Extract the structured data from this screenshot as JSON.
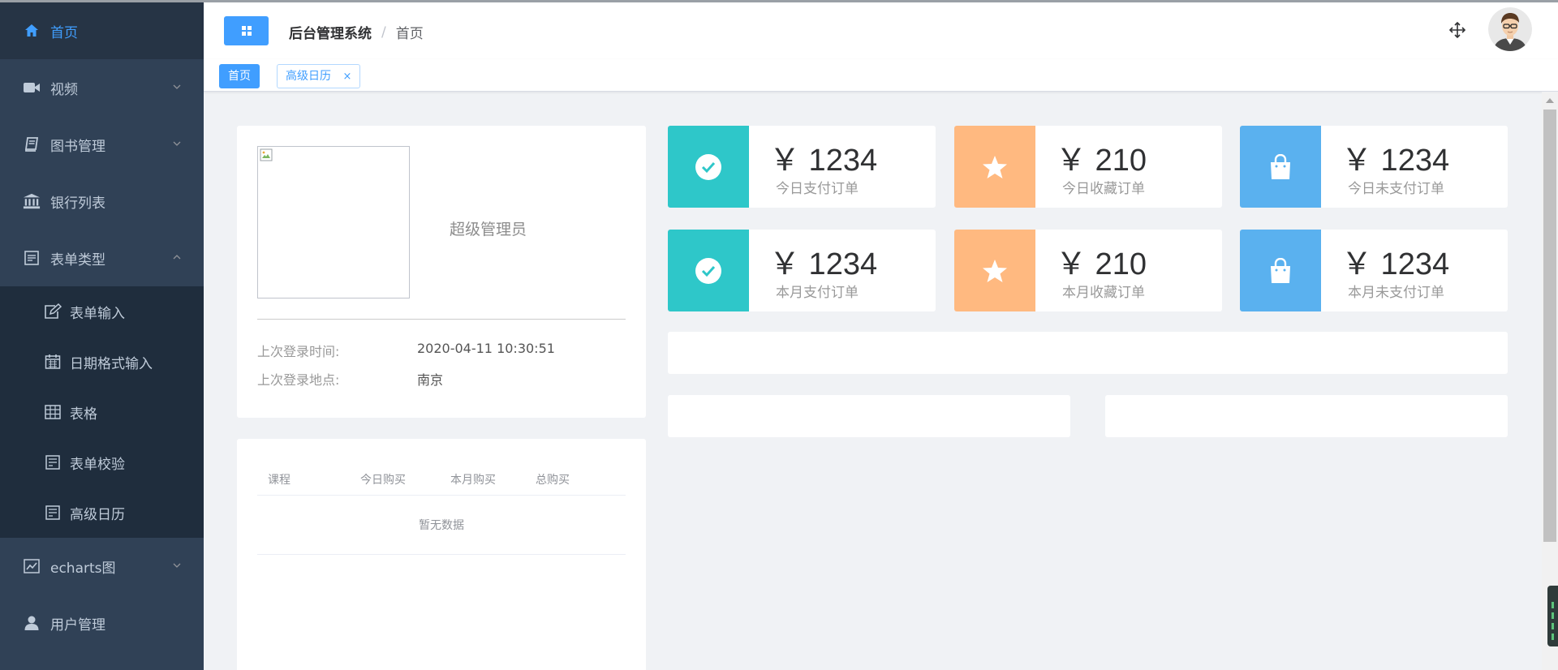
{
  "sidebar": {
    "items": [
      {
        "label": "首页",
        "icon": "home-icon"
      },
      {
        "label": "视频",
        "icon": "video-icon"
      },
      {
        "label": "图书管理",
        "icon": "book-icon"
      },
      {
        "label": "银行列表",
        "icon": "bank-icon"
      },
      {
        "label": "表单类型",
        "icon": "form-icon"
      },
      {
        "label": "echarts图",
        "icon": "chart-icon"
      },
      {
        "label": "用户管理",
        "icon": "user-icon"
      }
    ],
    "sub_items": [
      {
        "label": "表单输入",
        "icon": "edit-icon"
      },
      {
        "label": "日期格式输入",
        "icon": "calendar-icon"
      },
      {
        "label": "表格",
        "icon": "table-icon"
      },
      {
        "label": "表单校验",
        "icon": "form-check-icon"
      },
      {
        "label": "高级日历",
        "icon": "calendar-advanced-icon"
      }
    ]
  },
  "header": {
    "breadcrumb": [
      "后台管理系统",
      "首页"
    ],
    "separator": "/"
  },
  "tags": [
    {
      "label": "首页",
      "active": true
    },
    {
      "label": "高级日历",
      "active": false,
      "close": "×"
    }
  ],
  "user_card": {
    "role": "超级管理员",
    "rows": [
      {
        "label": "上次登录时间:",
        "value": "2020-04-11 10:30:51"
      },
      {
        "label": "上次登录地点:",
        "value": "南京"
      }
    ]
  },
  "table": {
    "headers": [
      "课程",
      "今日购买",
      "本月购买",
      "总购买"
    ],
    "empty_text": "暂无数据"
  },
  "stats": [
    {
      "value": "￥ 1234",
      "label": "今日支付订单",
      "color": "#2ec7c9",
      "icon": "check-circle-icon"
    },
    {
      "value": "￥ 210",
      "label": "今日收藏订单",
      "color": "#ffb980",
      "icon": "star-icon"
    },
    {
      "value": "￥ 1234",
      "label": "今日未支付订单",
      "color": "#5ab1ef",
      "icon": "shopping-bag-icon"
    },
    {
      "value": "￥ 1234",
      "label": "本月支付订单",
      "color": "#2ec7c9",
      "icon": "check-circle-icon"
    },
    {
      "value": "￥ 210",
      "label": "本月收藏订单",
      "color": "#ffb980",
      "icon": "star-icon"
    },
    {
      "value": "￥ 1234",
      "label": "本月未支付订单",
      "color": "#5ab1ef",
      "icon": "shopping-bag-icon"
    }
  ],
  "colors": {
    "sidebar_bg": "#304156",
    "accent": "#409eff"
  }
}
